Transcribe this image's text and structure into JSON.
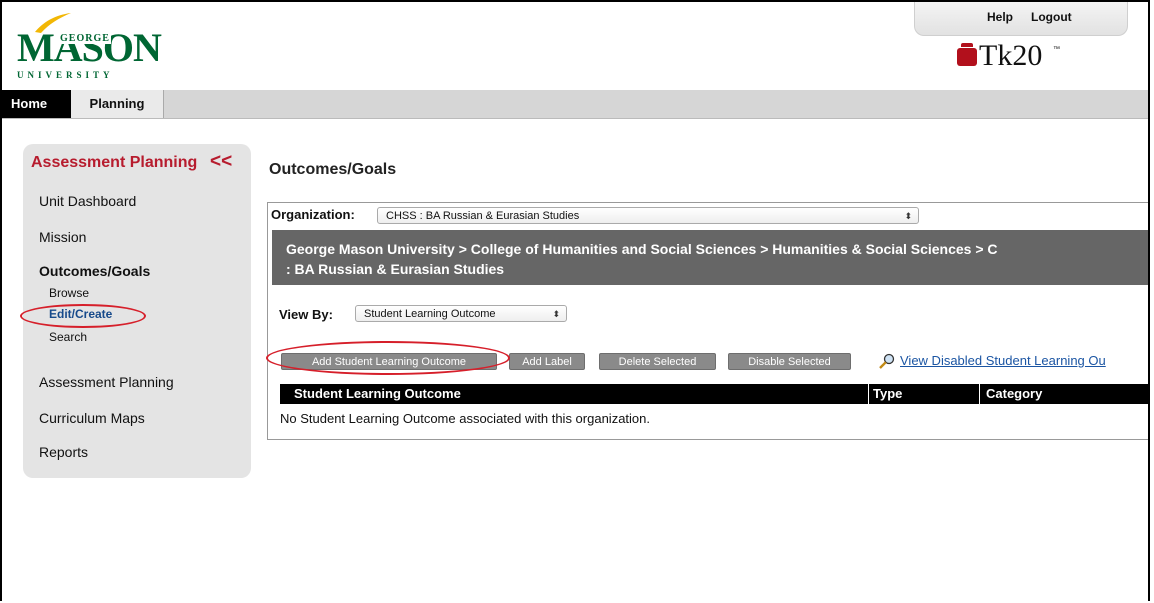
{
  "header": {
    "logo": {
      "george": "GEORGE",
      "mason": "MASON",
      "university": "UNIVERSITY"
    },
    "links": {
      "help": "Help",
      "logout": "Logout"
    },
    "product_logo": {
      "text": "Tk20",
      "tm": "™"
    }
  },
  "nav": {
    "tabs": [
      {
        "label": "Home",
        "active": true
      },
      {
        "label": "Planning",
        "active": false
      }
    ]
  },
  "sidebar": {
    "title": "Assessment Planning",
    "collapse_glyph": "<<",
    "items": {
      "unit_dashboard": "Unit Dashboard",
      "mission": "Mission",
      "outcomes_goals": "Outcomes/Goals",
      "browse": "Browse",
      "edit_create": "Edit/Create",
      "search": "Search",
      "assessment_planning": "Assessment Planning",
      "curriculum_maps": "Curriculum Maps",
      "reports": "Reports"
    }
  },
  "main": {
    "title": "Outcomes/Goals",
    "organization_label": "Organization:",
    "organization_value": "CHSS : BA Russian & Eurasian Studies",
    "breadcrumb_line1": "George Mason University > College of Humanities and Social Sciences > Humanities & Social Sciences > C",
    "breadcrumb_line2": ": BA Russian & Eurasian Studies",
    "view_by_label": "View By:",
    "view_by_value": "Student Learning Outcome",
    "buttons": {
      "add_slo": "Add Student Learning Outcome",
      "add_label": "Add Label",
      "delete_selected": "Delete Selected",
      "disable_selected": "Disable Selected"
    },
    "view_disabled_link": "View Disabled Student Learning Ou",
    "table": {
      "columns": [
        "Student Learning Outcome",
        "Type",
        "Category"
      ],
      "empty_message": "No Student Learning Outcome associated with this organization."
    }
  },
  "colors": {
    "accent_red": "#b71c2e",
    "mason_green": "#006633",
    "tk20_red": "#b2101c",
    "annotation_circle": "#d61f2a"
  }
}
